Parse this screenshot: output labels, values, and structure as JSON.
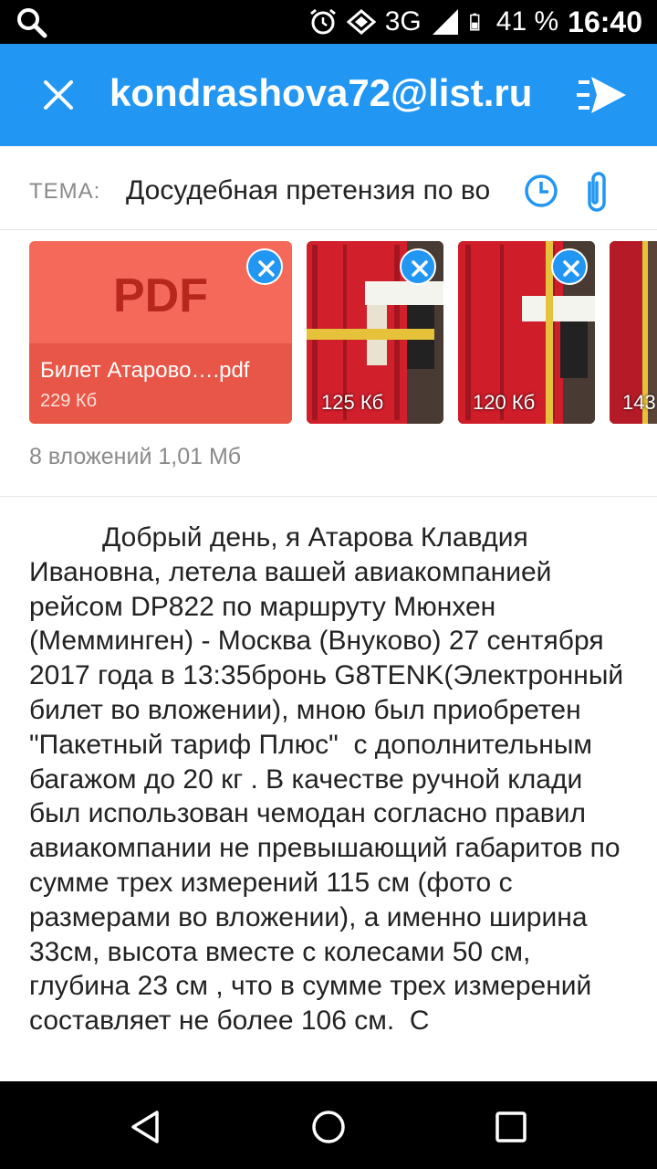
{
  "status_bar": {
    "network": "3G",
    "battery": "41 %",
    "time": "16:40"
  },
  "header": {
    "recipient": "kondrashova72@list.ru",
    "accent_color": "#2196F3"
  },
  "subject": {
    "label": "ТЕМА:",
    "value": "Досудебная претензия по возврату"
  },
  "attachments": {
    "items": [
      {
        "type": "pdf",
        "thumb_label": "PDF",
        "name": "Билет Атарово….pdf",
        "size": "229  Кб"
      },
      {
        "type": "image",
        "size": "125  Кб"
      },
      {
        "type": "image",
        "size": "120  Кб"
      },
      {
        "type": "image",
        "size": "143"
      }
    ],
    "summary": "8 вложений 1,01  Мб"
  },
  "body": {
    "text": "Добрый день, я Атарова Клавдия Ивановна, летела вашей авиакомпанией рейсом DP822 по маршруту Мюнхен (Мемминген) - Москва (Внуково) 27 сентября 2017 года в 13:35бронь G8TENK(Электронный билет во вложении), мною был приобретен \"Пакетный тариф Плюс\"  с дополнительным багажом до 20 кг . В качестве ручной клади был использован чемодан согласно правил авиакомпании не превышающий габаритов по сумме трех измерений 115 см (фото с размерами во вложении), а именно ширина 33см, высота вместе с колесами 50 см, глубина 23 см , что в сумме трех измерений составляет не более 106 см.  С"
  },
  "icons": {
    "status_search": "search-icon",
    "alarm": "alarm-icon",
    "data": "data-transfer-icon",
    "signal": "signal-icon",
    "battery": "battery-icon",
    "close": "close-icon",
    "send": "send-icon",
    "schedule": "clock-icon",
    "attach": "paperclip-icon",
    "remove": "remove-icon",
    "nav_back": "back-icon",
    "nav_home": "home-icon",
    "nav_recents": "recents-icon"
  }
}
